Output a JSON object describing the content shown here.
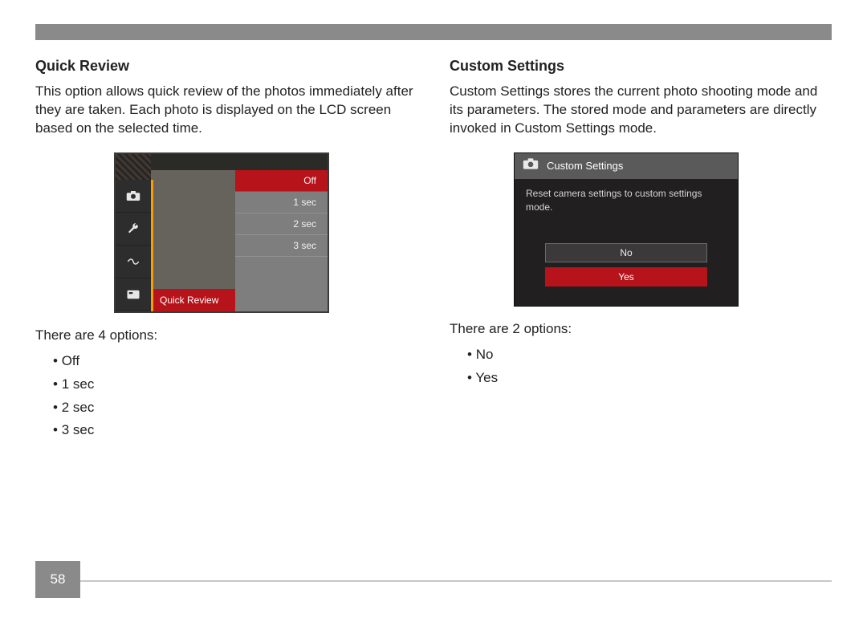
{
  "page_number": "58",
  "left": {
    "heading": "Quick Review",
    "paragraph": "This option allows quick review of the photos immediately after they are taken. Each photo is displayed on the LCD screen based on the selected time.",
    "options_intro": "There are 4 options:",
    "options": [
      "Off",
      "1 sec",
      "2 sec",
      "3 sec"
    ],
    "ui": {
      "label": "Quick Review",
      "menu": [
        "Off",
        "1 sec",
        "2 sec",
        "3 sec"
      ],
      "selected_index": 0,
      "icons": [
        "camera",
        "wrench",
        "flash",
        "card"
      ]
    }
  },
  "right": {
    "heading": "Custom Settings",
    "paragraph": "Custom Settings stores the current photo shooting mode and its parameters. The stored mode and parameters are directly invoked in Custom Settings mode.",
    "options_intro": "There are 2 options:",
    "options": [
      "No",
      "Yes"
    ],
    "ui": {
      "title": "Custom Settings",
      "description": "Reset camera settings to custom settings mode.",
      "buttons": {
        "no": "No",
        "yes": "Yes"
      },
      "selected": "yes"
    }
  }
}
